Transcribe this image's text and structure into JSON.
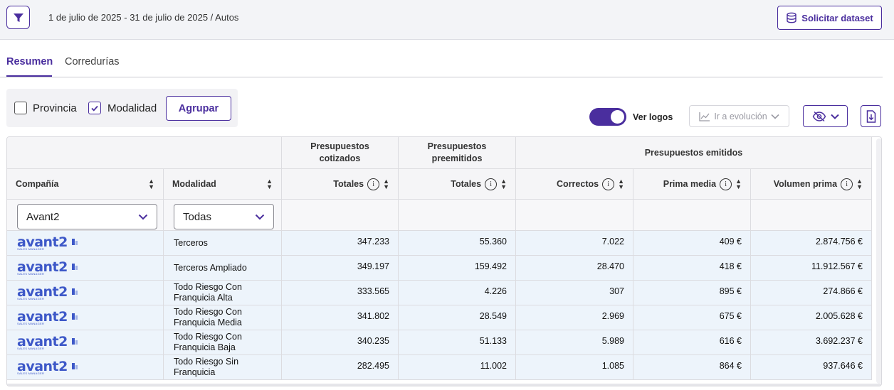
{
  "header": {
    "breadcrumb": "1 de julio de 2025 - 31 de julio de 2025 / Autos",
    "dataset_button": "Solicitar dataset"
  },
  "tabs": [
    {
      "label": "Resumen",
      "active": true
    },
    {
      "label": "Corredurías",
      "active": false
    }
  ],
  "grouping": {
    "options": [
      {
        "label": "Provincia",
        "checked": false
      },
      {
        "label": "Modalidad",
        "checked": true
      }
    ],
    "apply_label": "Agrupar"
  },
  "toolbar": {
    "logos_label": "Ver logos",
    "logos_on": true,
    "evolution_label": "Ir a evolución"
  },
  "table": {
    "group_headers": [
      "Presupuestos cotizados",
      "Presupuestos preemitidos",
      "Presupuestos emitidos"
    ],
    "columns": [
      "Compañía",
      "Modalidad",
      "Totales",
      "Totales",
      "Correctos",
      "Prima media",
      "Volumen prima"
    ],
    "filters": {
      "company": "Avant2",
      "modality": "Todas"
    },
    "rows": [
      {
        "company": "avant2",
        "company_sub": "SALES MANAGER",
        "modality": "Terceros",
        "cotizados": "347.233",
        "preemitidos": "55.360",
        "correctos": "7.022",
        "prima_media": "409 €",
        "volumen": "2.874.756 €"
      },
      {
        "company": "avant2",
        "company_sub": "SALES MANAGER",
        "modality": "Terceros Ampliado",
        "cotizados": "349.197",
        "preemitidos": "159.492",
        "correctos": "28.470",
        "prima_media": "418 €",
        "volumen": "11.912.567 €"
      },
      {
        "company": "avant2",
        "company_sub": "SALES MANAGER",
        "modality": "Todo Riesgo Con Franquicia Alta",
        "cotizados": "333.565",
        "preemitidos": "4.226",
        "correctos": "307",
        "prima_media": "895 €",
        "volumen": "274.866 €"
      },
      {
        "company": "avant2",
        "company_sub": "SALES MANAGER",
        "modality": "Todo Riesgo Con Franquicia Media",
        "cotizados": "341.802",
        "preemitidos": "28.549",
        "correctos": "2.969",
        "prima_media": "675 €",
        "volumen": "2.005.628 €"
      },
      {
        "company": "avant2",
        "company_sub": "SALES MANAGER",
        "modality": "Todo Riesgo Con Franquicia Baja",
        "cotizados": "340.235",
        "preemitidos": "51.133",
        "correctos": "5.989",
        "prima_media": "616 €",
        "volumen": "3.692.237 €"
      },
      {
        "company": "avant2",
        "company_sub": "SALES MANAGER",
        "modality": "Todo Riesgo Sin Franquicia",
        "cotizados": "282.495",
        "preemitidos": "11.002",
        "correctos": "1.085",
        "prima_media": "864 €",
        "volumen": "937.646 €"
      }
    ]
  },
  "colors": {
    "accent": "#4a2e9e",
    "row_bg": "#edf4fb",
    "logo": "#3d58c8"
  }
}
